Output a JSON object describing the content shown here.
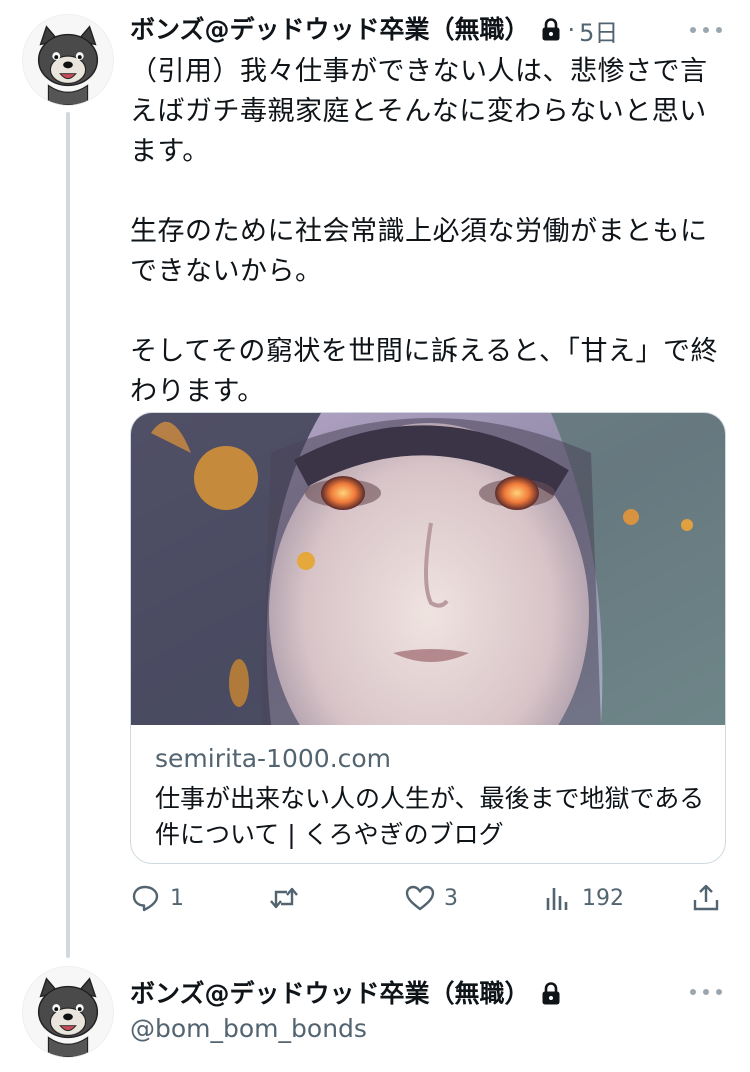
{
  "tweet": {
    "display_name": "ボンズ@デッドウッド卒業（無職）",
    "dot": "·",
    "time": "5日",
    "paragraphs": [
      "（引用）我々仕事ができない人は、悲惨さで言えばガチ毒親家庭とそんなに変わらないと思います。",
      "生存のために社会常識上必須な労働がまともにできないから。",
      "そしてその窮状を世間に訴えると、「甘え」で終わります。"
    ],
    "card": {
      "domain": "semirita-1000.com",
      "title": "仕事が出来ない人の人生が、最後まで地獄である件について | くろやぎのブログ"
    },
    "actions": {
      "replies": "1",
      "retweets": "",
      "likes": "3",
      "views": "192"
    }
  },
  "next_tweet": {
    "display_name": "ボンズ@デッドウッド卒業（無職）",
    "handle": "@bom_bom_bonds"
  },
  "colors": {
    "text_primary": "#0f1419",
    "text_secondary": "#536471",
    "border": "#cfd9de"
  },
  "icons": {
    "reply": "reply-icon",
    "retweet": "retweet-icon",
    "like": "like-icon",
    "views": "views-icon",
    "share": "share-icon",
    "lock": "lock-icon",
    "more": "more-icon"
  }
}
